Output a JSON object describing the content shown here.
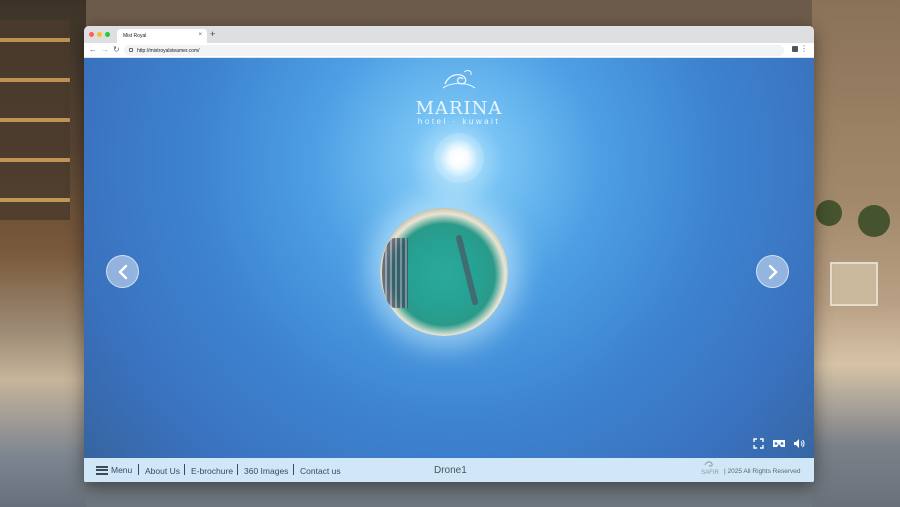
{
  "browser": {
    "tab_title": "Mist Royal",
    "tab_close": "×",
    "new_tab": "+",
    "url": "http://mistroyalsteamer.com/",
    "nav": {
      "back": "←",
      "forward": "→",
      "reload": "↻"
    },
    "menu": "⋮"
  },
  "viewer": {
    "logo": {
      "title": "MARINA",
      "subtitle": "hotel · kuwait"
    },
    "prev_icon": "chevron-left-icon",
    "next_icon": "chevron-right-icon",
    "controls": [
      "fullscreen-icon",
      "vr-goggles-icon",
      "volume-icon"
    ]
  },
  "footer": {
    "menu_label": "Menu",
    "links": [
      "About Us",
      "E-brochure",
      "360 Images",
      "Contact us"
    ],
    "scene_name": "Drone1",
    "brand": "SAFIR",
    "rights": "| 2025 All Rights Reserved"
  },
  "colors": {
    "sky": "#4d9fe4",
    "footer_bg": "#cfe7f7",
    "footer_text": "#3b4b5c",
    "traffic_red": "#ff5f57",
    "traffic_yellow": "#febc2e",
    "traffic_green": "#28c840"
  }
}
